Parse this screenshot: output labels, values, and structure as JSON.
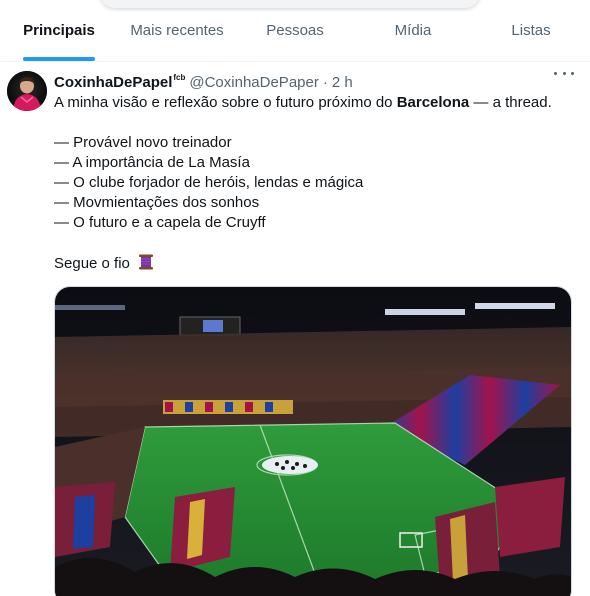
{
  "tabs": [
    {
      "label": "Principais",
      "active": true
    },
    {
      "label": "Mais recentes",
      "active": false
    },
    {
      "label": "Pessoas",
      "active": false
    },
    {
      "label": "Mídia",
      "active": false
    },
    {
      "label": "Listas",
      "active": false
    }
  ],
  "tweet": {
    "display_name": "CoxinhaDePapel",
    "name_suffix": "fcb",
    "handle": "@CoxinhaDePaper",
    "separator": "·",
    "time": "2 h",
    "line1_pre": "A minha visão e reflexão sobre o futuro próximo do ",
    "line1_bold": "Barcelona",
    "line1_post": " — a thread.",
    "topics": [
      "— Provável novo treinador",
      "— A importância de La Masía",
      "— O clube forjador de heróis, lendas e mágica",
      "— Movmientações dos sonhos",
      "— O futuro e a capela de Cruyff"
    ],
    "closing": "Segue o fio",
    "closing_icon": "spool-icon",
    "media_description_icon": "stadium-photo"
  },
  "colors": {
    "accent": "#1d9bf0",
    "text_primary": "#0f1419",
    "text_secondary": "#536471",
    "border": "#eff3f4"
  }
}
